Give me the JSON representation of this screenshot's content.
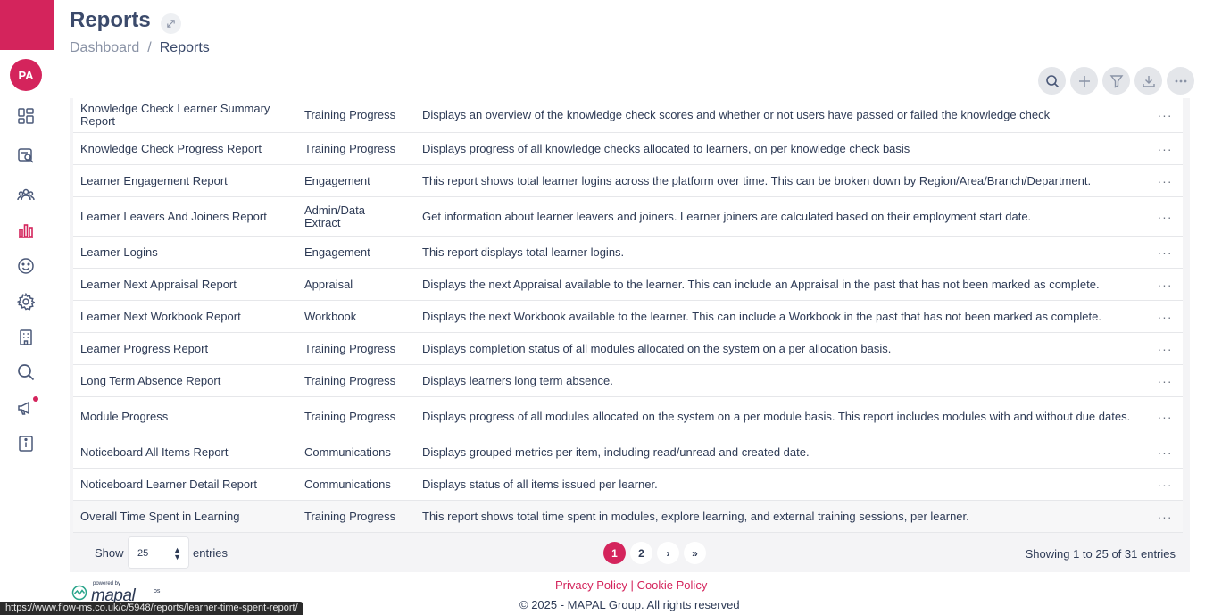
{
  "user": {
    "initials": "PA"
  },
  "header": {
    "title": "Reports"
  },
  "breadcrumb": {
    "home": "Dashboard",
    "separator": "/",
    "current": "Reports"
  },
  "table": {
    "rows": [
      {
        "name": "Knowledge Check Learner Summary Report",
        "category": "Training Progress",
        "description": "Displays an overview of the knowledge check scores and whether or not users have passed or failed the knowledge check"
      },
      {
        "name": "Knowledge Check Progress Report",
        "category": "Training Progress",
        "description": "Displays progress of all knowledge checks allocated to learners, on per knowledge check basis"
      },
      {
        "name": "Learner Engagement Report",
        "category": "Engagement",
        "description": "This report shows total learner logins across the platform over time. This can be broken down by Region/Area/Branch/Department."
      },
      {
        "name": "Learner Leavers And Joiners Report",
        "category": "Admin/Data Extract",
        "description": "Get information about learner leavers and joiners. Learner joiners are calculated based on their employment start date."
      },
      {
        "name": "Learner Logins",
        "category": "Engagement",
        "description": "This report displays total learner logins."
      },
      {
        "name": "Learner Next Appraisal Report",
        "category": "Appraisal",
        "description": "Displays the next Appraisal available to the learner. This can include an Appraisal in the past that has not been marked as complete."
      },
      {
        "name": "Learner Next Workbook Report",
        "category": "Workbook",
        "description": "Displays the next Workbook available to the learner. This can include a Workbook in the past that has not been marked as complete."
      },
      {
        "name": "Learner Progress Report",
        "category": "Training Progress",
        "description": "Displays completion status of all modules allocated on the system on a per allocation basis."
      },
      {
        "name": "Long Term Absence Report",
        "category": "Training Progress",
        "description": "Displays learners long term absence."
      },
      {
        "name": "Module Progress",
        "category": "Training Progress",
        "description": "Displays progress of all modules allocated on the system on a per module basis. This report includes modules with and without due dates."
      },
      {
        "name": "Noticeboard All Items Report",
        "category": "Communications",
        "description": "Displays grouped metrics per item, including read/unread and created date."
      },
      {
        "name": "Noticeboard Learner Detail Report",
        "category": "Communications",
        "description": "Displays status of all items issued per learner."
      },
      {
        "name": "Overall Time Spent in Learning",
        "category": "Training Progress",
        "description": "This report shows total time spent in modules, explore learning, and external training sessions, per learner."
      }
    ],
    "row_menu_glyph": "···"
  },
  "pagination": {
    "show_label": "Show",
    "page_size": "25",
    "entries_label": "entries",
    "pages": [
      "1",
      "2"
    ],
    "current_page": "1",
    "next_glyph": "›",
    "last_glyph": "»",
    "summary": "Showing 1 to 25 of 31 entries"
  },
  "footer": {
    "privacy": "Privacy Policy",
    "divider": "|",
    "cookie": "Cookie Policy",
    "copyright": "© 2025 - MAPAL Group. All rights reserved",
    "powered_by": "powered by",
    "brand": "mapal",
    "brand_suffix": "os"
  },
  "status_bar": {
    "url": "https://www.flow-ms.co.uk/c/5948/reports/learner-time-spent-report/"
  },
  "colors": {
    "accent": "#d4245c",
    "text": "#2d3a55",
    "muted": "#8a93a6"
  }
}
